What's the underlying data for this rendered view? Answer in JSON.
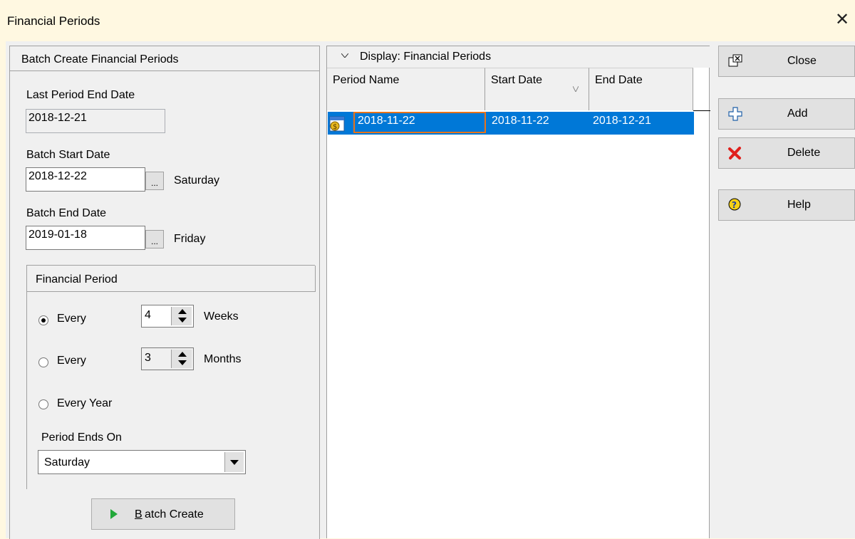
{
  "window": {
    "title": "Financial Periods",
    "close_glyph": "✕"
  },
  "batch_panel": {
    "header": "Batch Create Financial Periods",
    "last_period_end_label": "Last Period End Date",
    "last_period_end_value": "2018-12-21",
    "batch_start_label": "Batch Start Date",
    "batch_start_value": "2018-12-22",
    "batch_start_day": "Saturday",
    "batch_end_label": "Batch End Date",
    "batch_end_value": "2019-01-18",
    "batch_end_day": "Friday",
    "ellipsis": "...",
    "financial_period": {
      "header": "Financial Period",
      "every_weeks_label": "Every",
      "weeks_value": "4",
      "weeks_unit": "Weeks",
      "every_months_label": "Every",
      "months_value": "3",
      "months_unit": "Months",
      "every_year_label": "Every Year",
      "selected_option": "weeks",
      "period_ends_on_label": "Period Ends On",
      "period_ends_on_value": "Saturday"
    },
    "batch_create_button_mnemonic": "B",
    "batch_create_button_rest": "atch Create"
  },
  "grid": {
    "title": "Display: Financial Periods",
    "columns": [
      "Period Name",
      "Start Date",
      "End Date"
    ],
    "rows": [
      {
        "period_name": "2018-11-22",
        "start_date": "2018-11-22",
        "end_date": "2018-12-21",
        "selected": true
      }
    ]
  },
  "toolbar": {
    "close_label": "Close",
    "add_label": "Add",
    "delete_label": "Delete",
    "help_label": "Help"
  },
  "colors": {
    "selection": "#0078d7",
    "edit_border": "#e8741a",
    "title_background": "#fff8e1",
    "panel": "#f0f0f0",
    "add_icon": "#1e5fa8",
    "delete_icon": "#e0201c",
    "help_icon": "#f4d016",
    "play_icon": "#22a83a"
  }
}
